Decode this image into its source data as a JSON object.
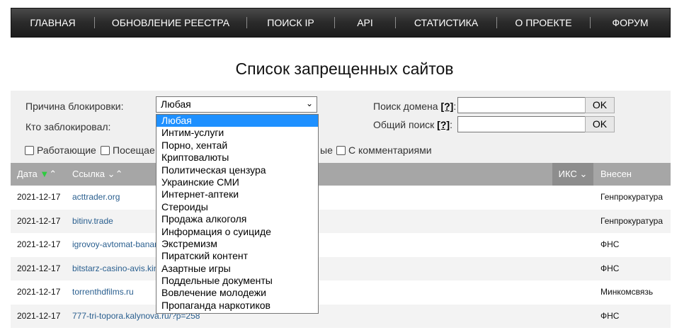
{
  "nav": {
    "items": [
      {
        "label": "Главная"
      },
      {
        "label": "Обновление реестра"
      },
      {
        "label": "Поиск IP"
      },
      {
        "label": "API"
      },
      {
        "label": "Статистика"
      },
      {
        "label": "О проекте"
      },
      {
        "label": "Форум"
      }
    ]
  },
  "page": {
    "title": "Список запрещенных сайтов"
  },
  "filters": {
    "reason_label": "Причина блокировки:",
    "reason_value": "Любая",
    "blocker_label": "Кто заблокировал:",
    "domain_search_label": "Поиск домена",
    "general_search_label": "Общий поиск",
    "help": "[?]",
    "ok_label": "OK",
    "checkboxes": [
      "Работающие",
      "Посещае",
      "ые",
      "С комментариями"
    ]
  },
  "dropdown": {
    "options": [
      "Любая",
      "Интим-услуги",
      "Порно, хентай",
      "Криптовалюты",
      "Политическая цензура",
      "Украинские СМИ",
      "Интернет-аптеки",
      "Стероиды",
      "Продажа алкоголя",
      "Информация о суициде",
      "Экстремизм",
      "Пиратский контент",
      "Азартные игры",
      "Поддельные документы",
      "Вовлечение молодежи",
      "Пропаганда наркотиков"
    ]
  },
  "table": {
    "headers": {
      "date": "Дата",
      "link": "Ссылка",
      "ikc": "ИКС",
      "added": "Внесен"
    },
    "rows": [
      {
        "date": "2021-12-17",
        "link": "acttrader.org",
        "by": "Генпрокуратура"
      },
      {
        "date": "2021-12-17",
        "link": "bitinv.trade",
        "by": "Генпрокуратура"
      },
      {
        "date": "2021-12-17",
        "link": "igrovoy-avtomat-banan",
        "by": "ФНС"
      },
      {
        "date": "2021-12-17",
        "link": "bitstarz-casino-avis.kin",
        "by": "ФНС"
      },
      {
        "date": "2021-12-17",
        "link": "torrenthdfilms.ru",
        "by": "Минкомсвязь"
      },
      {
        "date": "2021-12-17",
        "link": "777-tri-topora.kalynova.ru/?p=258",
        "by": "ФНС"
      }
    ]
  },
  "colors": {
    "nav_bg": "#2a2a2a",
    "header_bg": "#a6a6a6",
    "sort_active": "#2ecc40",
    "dropdown_selected": "#1e90ff",
    "link": "#2a5f8f"
  }
}
